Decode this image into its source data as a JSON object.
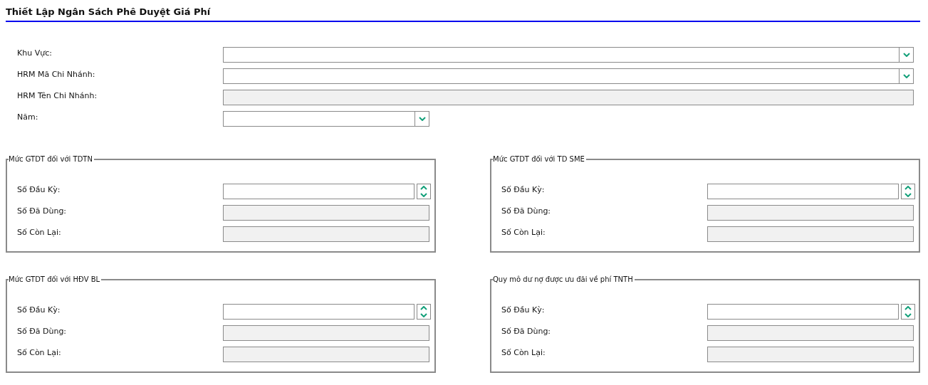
{
  "title": "Thiết Lập Ngân Sách Phê Duyệt Giá Phí",
  "fields": [
    {
      "label": "Khu Vực:",
      "kind": "dropdown",
      "wide": true
    },
    {
      "label": "HRM Mã Chi Nhánh:",
      "kind": "dropdown",
      "wide": true
    },
    {
      "label": "HRM Tên Chi Nhánh:",
      "kind": "readonly",
      "wide": true
    },
    {
      "label": "Năm:",
      "kind": "dropdown",
      "wide": false
    }
  ],
  "groups": [
    {
      "legend": "Mức GTDT đối với TDTN",
      "fields": [
        {
          "label": "Số Đầu Kỳ:",
          "kind": "spinner"
        },
        {
          "label": "Số Đã Dùng:",
          "kind": "readonly"
        },
        {
          "label": "Số Còn Lại:",
          "kind": "readonly"
        }
      ]
    },
    {
      "legend": "Mức GTDT đối với TD SME",
      "fields": [
        {
          "label": "Số Đầu Kỳ:",
          "kind": "spinner"
        },
        {
          "label": "Số Đã Dùng:",
          "kind": "readonly"
        },
        {
          "label": "Số Còn Lại:",
          "kind": "readonly"
        }
      ]
    },
    {
      "legend": "Mức GTDT đối với HĐV BL",
      "fields": [
        {
          "label": "Số Đầu Kỳ:",
          "kind": "spinner"
        },
        {
          "label": "Số Đã Dùng:",
          "kind": "readonly"
        },
        {
          "label": "Số Còn Lại:",
          "kind": "readonly"
        }
      ]
    },
    {
      "legend": "Quy mô dư nợ được ưu đãi về phí TNTH",
      "fields": [
        {
          "label": "Số Đầu Kỳ:",
          "kind": "spinner"
        },
        {
          "label": "Số Đã Dùng:",
          "kind": "readonly"
        },
        {
          "label": "Số Còn Lại:",
          "kind": "readonly"
        }
      ]
    }
  ]
}
